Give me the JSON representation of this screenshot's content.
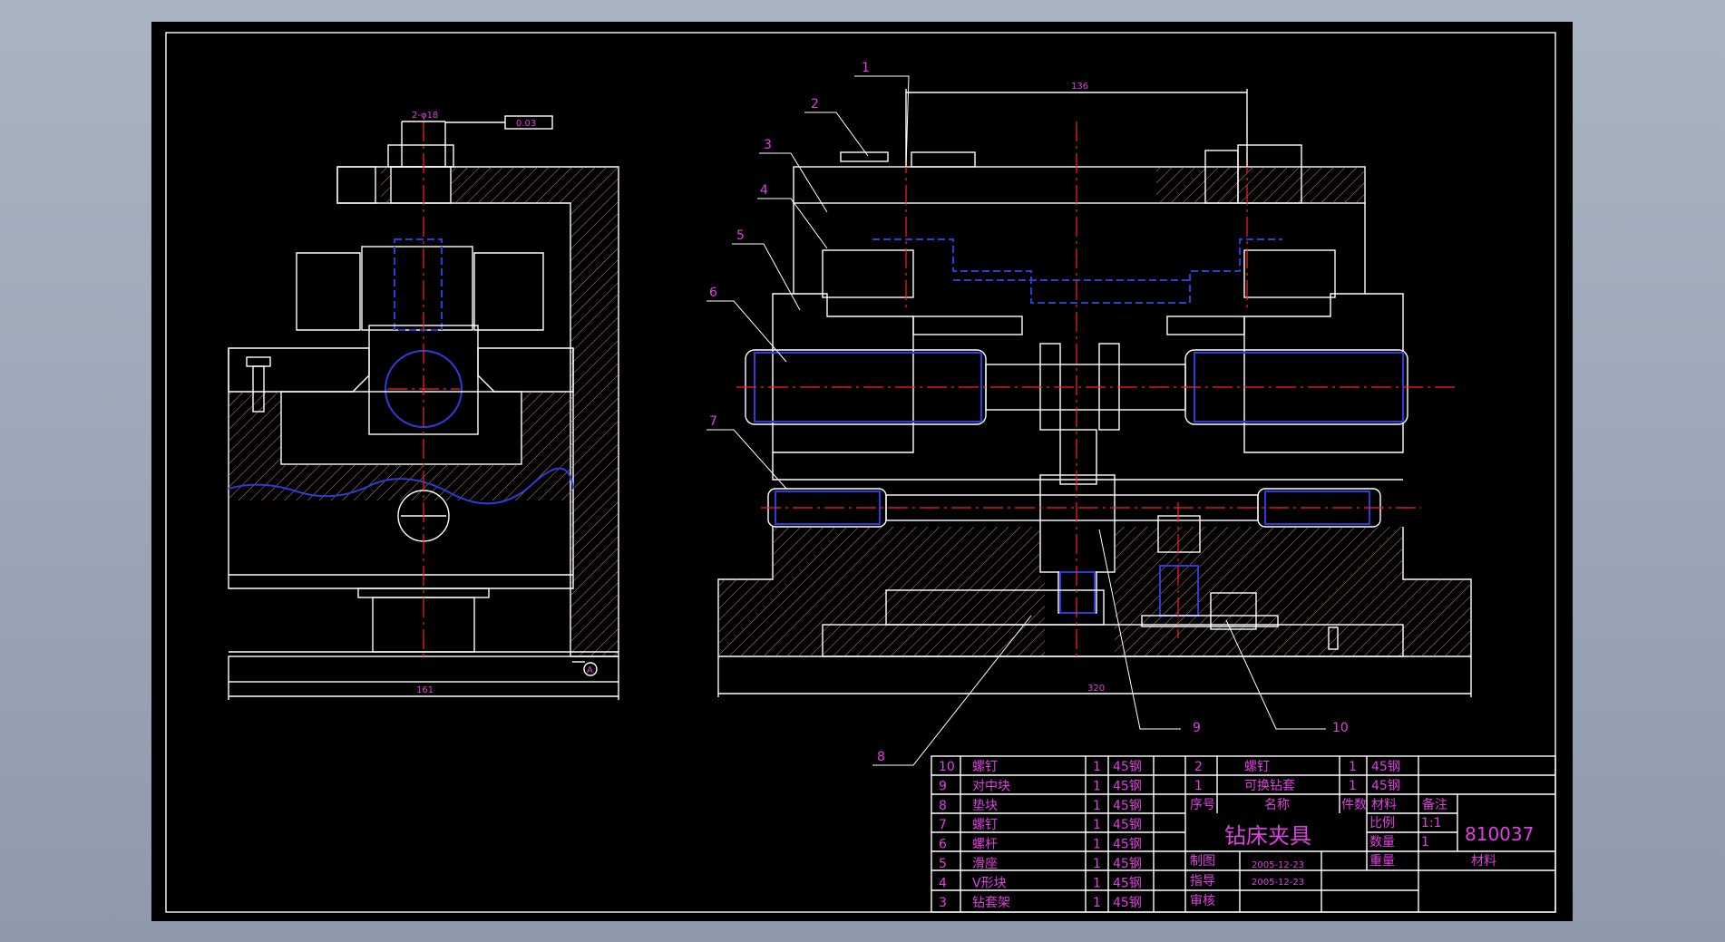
{
  "drawing": {
    "dims": {
      "top_width": "136",
      "left_hole": "2-φ18",
      "tolerance": "0.03",
      "left_width": "161",
      "right_width": "320",
      "datum": "A"
    },
    "balloons": [
      "1",
      "2",
      "3",
      "4",
      "5",
      "6",
      "7",
      "8",
      "9",
      "10"
    ]
  },
  "title_block": {
    "bom_left": [
      {
        "no": "10",
        "name": "螺钉",
        "qty": "1",
        "mat": "45钢"
      },
      {
        "no": "9",
        "name": "对中块",
        "qty": "1",
        "mat": "45钢"
      },
      {
        "no": "8",
        "name": "垫块",
        "qty": "1",
        "mat": "45钢"
      },
      {
        "no": "7",
        "name": "螺钉",
        "qty": "1",
        "mat": "45钢"
      },
      {
        "no": "6",
        "name": "螺杆",
        "qty": "1",
        "mat": "45钢"
      },
      {
        "no": "5",
        "name": "滑座",
        "qty": "1",
        "mat": "45钢"
      },
      {
        "no": "4",
        "name": "V形块",
        "qty": "1",
        "mat": "45钢"
      },
      {
        "no": "3",
        "name": "钻套架",
        "qty": "1",
        "mat": "45钢"
      }
    ],
    "bom_right": [
      {
        "no": "2",
        "name": "螺钉",
        "qty": "1",
        "mat": "45钢"
      },
      {
        "no": "1",
        "name": "可换钻套",
        "qty": "1",
        "mat": "45钢"
      }
    ],
    "header": {
      "no": "序号",
      "name": "名称",
      "qty": "件数",
      "mat": "材料",
      "note": "备注"
    },
    "title": "钻床夹具",
    "drawing_no": "810037",
    "scale_label": "比例",
    "scale_value": "1:1",
    "qty_label": "数量",
    "qty_value": "1",
    "weight_label": "重量",
    "material_label": "材料",
    "drawn_label": "制图",
    "guided_label": "指导",
    "checked_label": "审核",
    "date1": "2005-12-23",
    "date2": "2005-12-23"
  }
}
